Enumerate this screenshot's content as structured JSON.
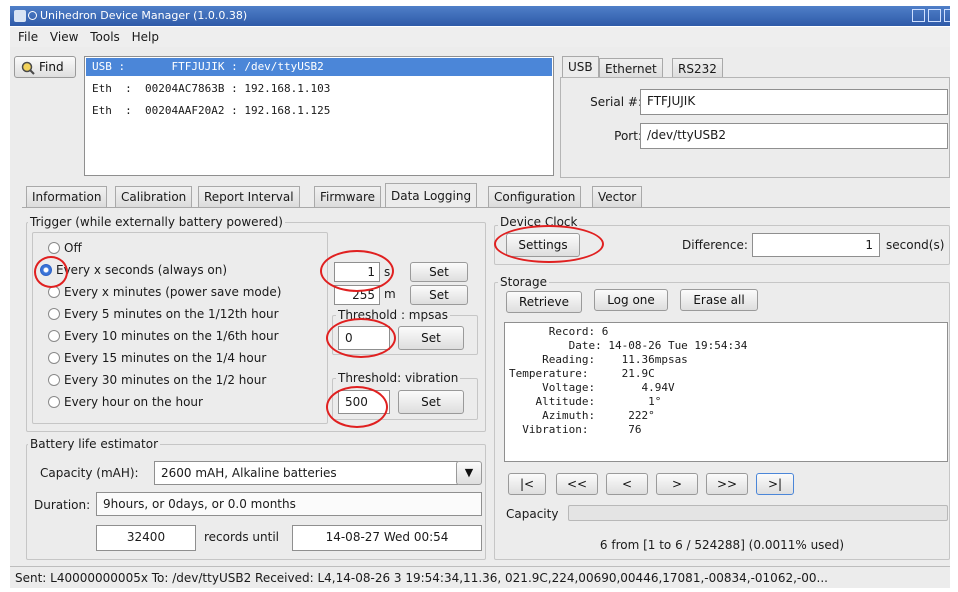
{
  "window": {
    "title": "Unihedron Device Manager  (1.0.0.38)"
  },
  "menu": {
    "file": "File",
    "view": "View",
    "tools": "Tools",
    "help": "Help"
  },
  "find_label": "Find",
  "devices": [
    "USB :       FTFJUJIK : /dev/ttyUSB2",
    "Eth  :  00204AC7863B : 192.168.1.103",
    "Eth  :  00204AAF20A2 : 192.168.1.125"
  ],
  "conn_tabs": [
    "USB",
    "Ethernet",
    "RS232"
  ],
  "conn": {
    "serial_label": "Serial #:",
    "serial_value": "FTFJUJIK",
    "port_label": "Port:",
    "port_value": "/dev/ttyUSB2"
  },
  "main_tabs": [
    "Information",
    "Calibration",
    "Report Interval",
    "Firmware",
    "Data Logging",
    "Configuration",
    "Vector"
  ],
  "trigger": {
    "legend": "Trigger (while externally battery powered)",
    "options": [
      "Off",
      "Every x seconds (always on)",
      "Every x minutes (power save mode)",
      "Every 5 minutes on the 1/12th hour",
      "Every 10 minutes on the 1/6th hour",
      "Every 15 minutes on the 1/4 hour",
      "Every  30 minutes on the 1/2 hour",
      "Every hour on the hour"
    ],
    "seconds_value": "1",
    "seconds_unit": "s",
    "minutes_value": "255",
    "minutes_unit": "m",
    "set_label": "Set",
    "threshold_mpsas_label": "Threshold : mpsas",
    "threshold_mpsas_value": "0",
    "threshold_vibration_label": "Threshold: vibration",
    "threshold_vibration_value": "500"
  },
  "battery": {
    "legend": "Battery life estimator",
    "capacity_label": "Capacity (mAH):",
    "capacity_value": "2600 mAH, Alkaline batteries",
    "duration_label": "Duration:",
    "duration_value": "9hours, or 0days, or 0.0 months",
    "records_value": "32400",
    "records_until_label": "records until",
    "until_value": "14-08-27 Wed 00:54"
  },
  "device_clock": {
    "legend": "Device Clock",
    "settings_label": "Settings",
    "difference_label": "Difference:",
    "difference_value": "1",
    "difference_unit": "second(s)"
  },
  "storage": {
    "legend": "Storage",
    "retrieve_label": "Retrieve",
    "logone_label": "Log one",
    "eraseall_label": "Erase all",
    "record_lines": [
      "      Record: 6",
      "         Date: 14-08-26 Tue 19:54:34",
      "     Reading:    11.36mpsas",
      "Temperature:     21.9C",
      "     Voltage:       4.94V",
      "    Altitude:        1°",
      "     Azimuth:     222°",
      "  Vibration:      76"
    ],
    "nav": [
      "|<",
      "<<",
      "<",
      ">",
      ">>",
      ">|"
    ],
    "capacity_label": "Capacity",
    "used_text": "6 from [1 to 6 / 524288] (0.0011% used)"
  },
  "status": {
    "text": "Sent: L40000000005x   To: /dev/ttyUSB2   Received: L4,14-08-26 3 19:54:34,11.36, 021.9C,224,00690,00446,17081,-00834,-01062,-00..."
  },
  "colors": {
    "annotation_red": "#e02020",
    "title_blue": "#3a6ab8",
    "selection_blue": "#4b86d8"
  }
}
